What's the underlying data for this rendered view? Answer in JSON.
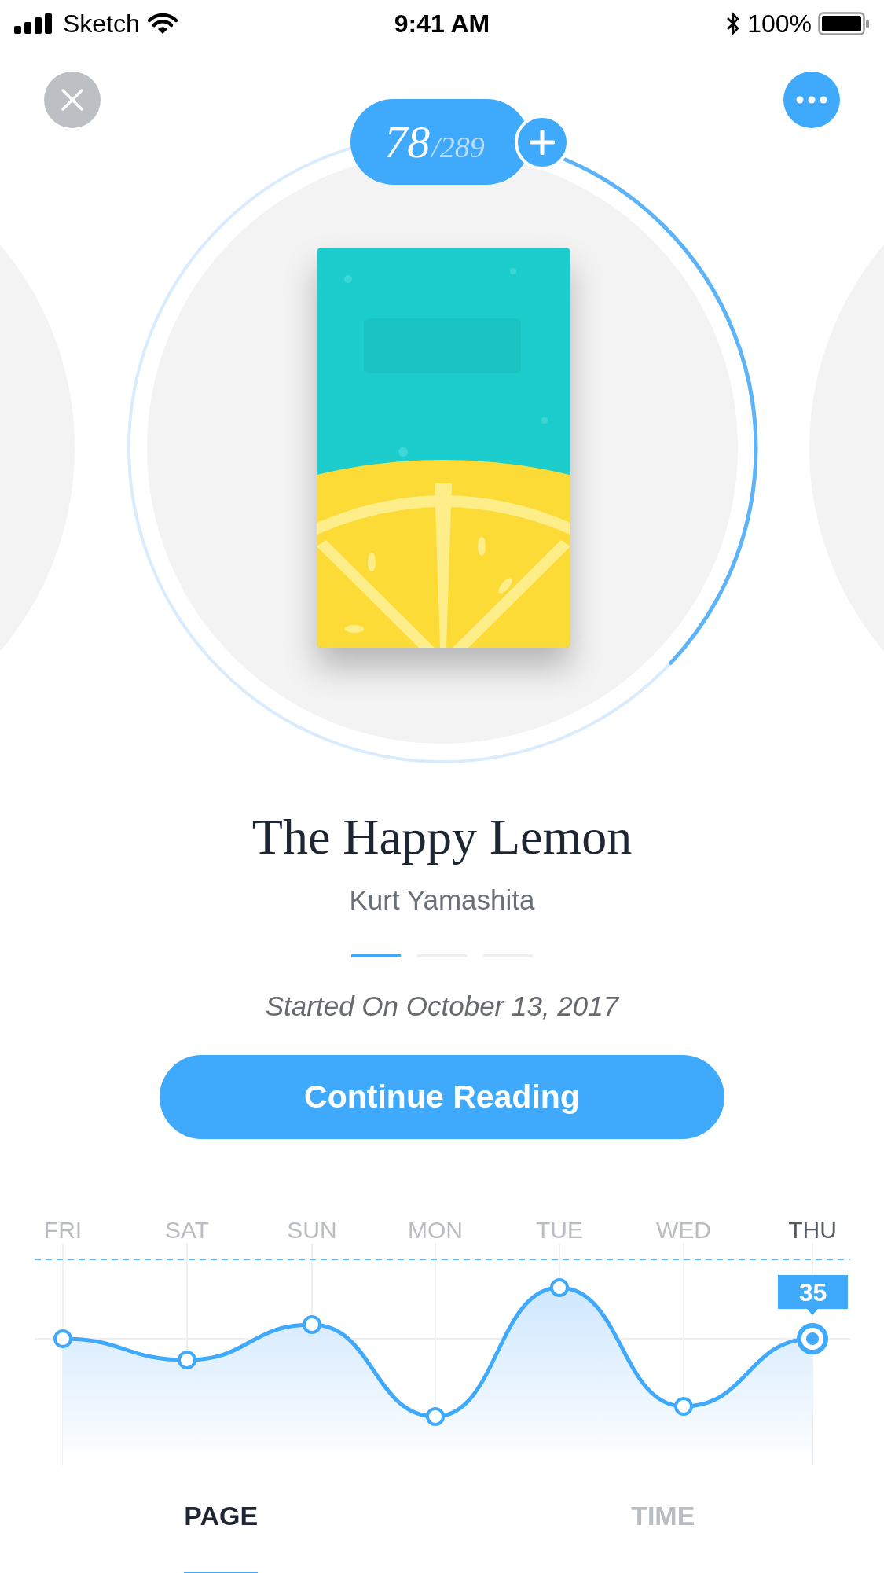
{
  "status_bar": {
    "carrier": "Sketch",
    "time": "9:41 AM",
    "battery": "100%"
  },
  "reading_progress": {
    "current": "78",
    "total": "/289",
    "level": 0.37
  },
  "book": {
    "title": "The Happy Lemon",
    "author": "Kurt Yamashita",
    "started": "Started On October 13, 2017"
  },
  "page_indicator": [
    {
      "selected": true
    },
    {
      "selected": false
    },
    {
      "selected": false
    }
  ],
  "primary_button": "Continue Reading",
  "chart": {
    "days": [
      {
        "label": "FRI",
        "selected": false
      },
      {
        "label": "SAT",
        "selected": false
      },
      {
        "label": "SUN",
        "selected": false
      },
      {
        "label": "MON",
        "selected": false
      },
      {
        "label": "TUE",
        "selected": false
      },
      {
        "label": "WED",
        "selected": false
      },
      {
        "label": "THU",
        "selected": true
      }
    ],
    "callout": "35"
  },
  "tabs": [
    {
      "label": "PAGE",
      "selected": true
    },
    {
      "label": "TIME",
      "selected": false
    }
  ]
}
